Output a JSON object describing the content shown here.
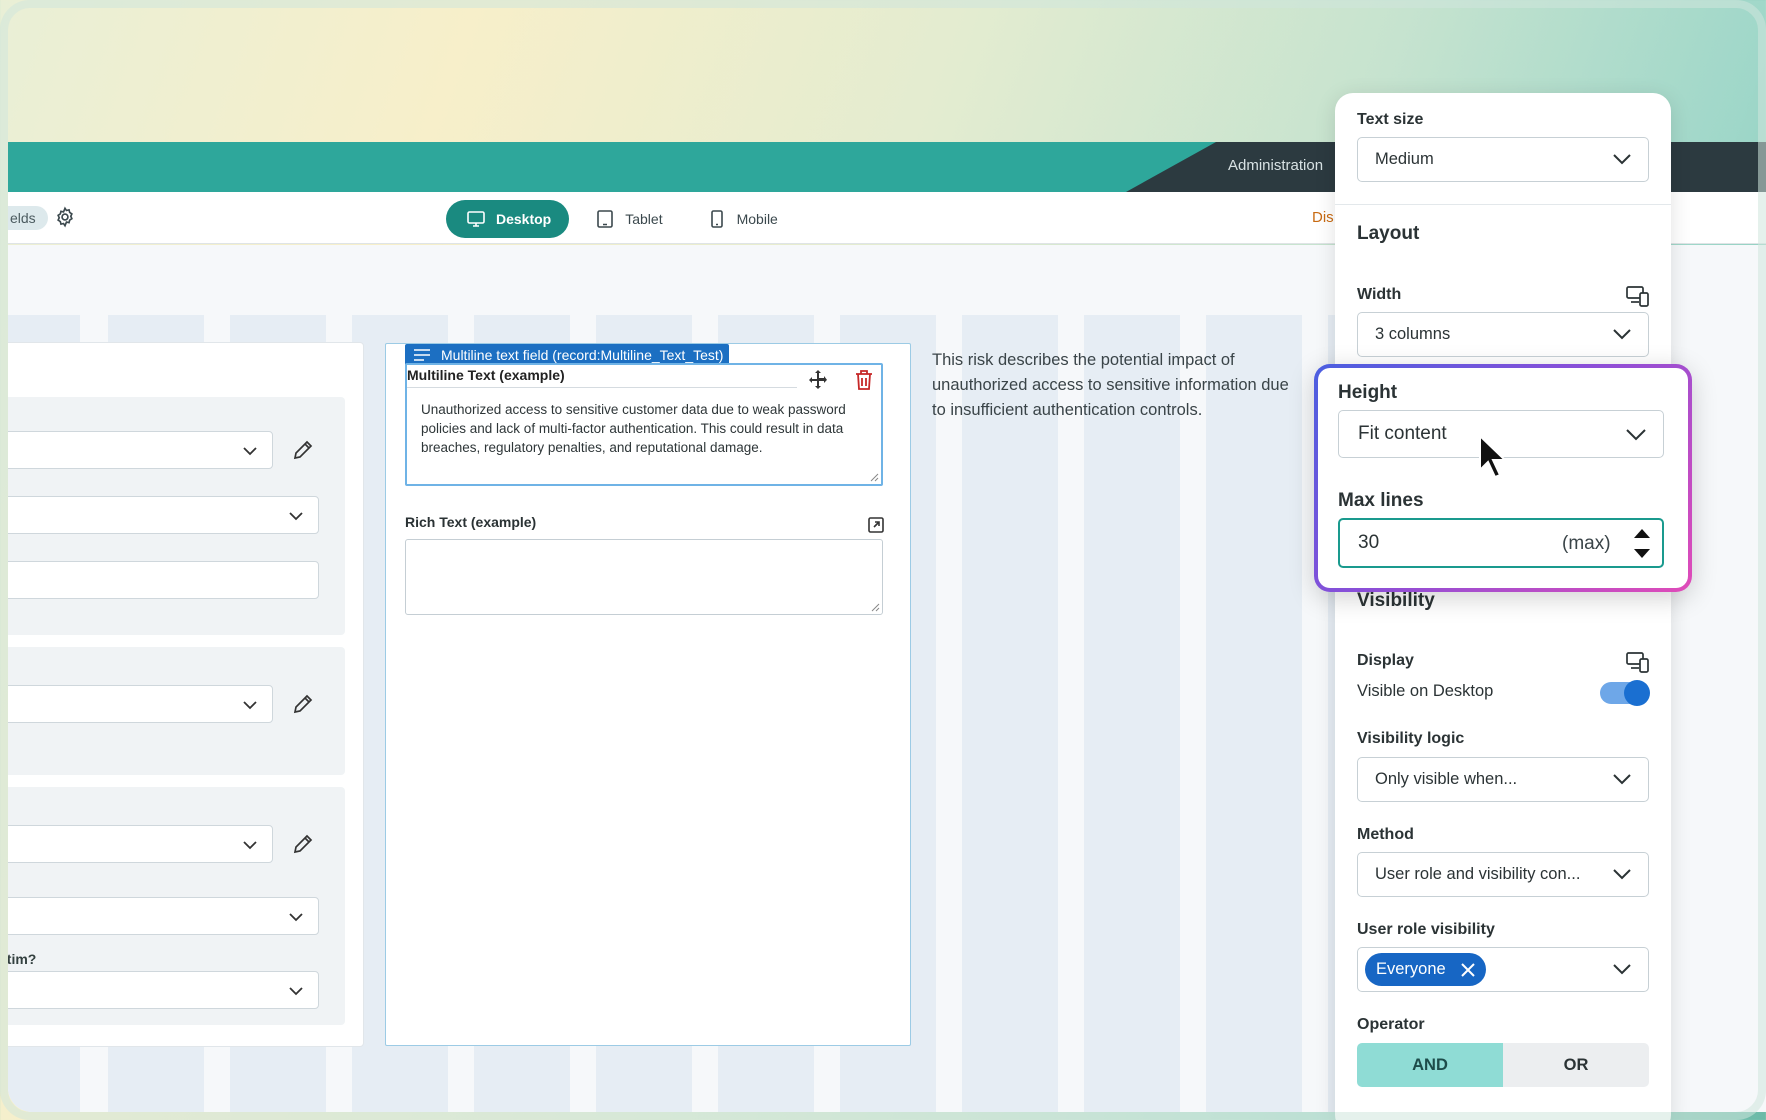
{
  "topbar": {
    "admin_label": "Administration"
  },
  "toolbar": {
    "fields_label": "elds",
    "device_tabs": [
      {
        "label": "Desktop",
        "icon": "desktop-icon",
        "active": true
      },
      {
        "label": "Tablet",
        "icon": "tablet-icon",
        "active": false
      },
      {
        "label": "Mobile",
        "icon": "mobile-icon",
        "active": false
      }
    ],
    "dis_label": "Dis"
  },
  "left_form": {
    "victim_label": "ctim?"
  },
  "multiline_field": {
    "tag": "Multiline text field (record:Multiline_Text_Test)",
    "label": "Multiline Text (example)",
    "value": "Unauthorized access to sensitive customer data due to weak password policies and lack of multi-factor authentication. This could result in data breaches, regulatory penalties, and reputational damage."
  },
  "rich_text_field": {
    "label": "Rich Text (example)"
  },
  "description": "This risk describes the potential impact of unauthorized access to sensitive information due to insufficient authentication controls.",
  "panel": {
    "text_size": {
      "label": "Text size",
      "value": "Medium"
    },
    "layout_heading": "Layout",
    "width": {
      "label": "Width",
      "value": "3 columns"
    },
    "height": {
      "label": "Height",
      "value": "Fit content"
    },
    "max_lines": {
      "label": "Max lines",
      "value": "30",
      "suffix": "(max)"
    },
    "visibility_heading": "Visibility",
    "display": {
      "label": "Display",
      "value": "Visible on Desktop",
      "toggle_on": true
    },
    "visibility_logic": {
      "label": "Visibility logic",
      "value": "Only visible when..."
    },
    "method": {
      "label": "Method",
      "value": "User role and visibility con..."
    },
    "user_role": {
      "label": "User role visibility",
      "chip": "Everyone"
    },
    "operator": {
      "label": "Operator",
      "options": [
        "AND",
        "OR"
      ],
      "selected": "AND"
    }
  },
  "colors": {
    "teal_bar": "#2ea79b",
    "dark_bar": "#2c3a40",
    "accent_blue": "#1766c4",
    "active_tab": "#1a8a80",
    "operator_on": "#8fdcd5"
  }
}
